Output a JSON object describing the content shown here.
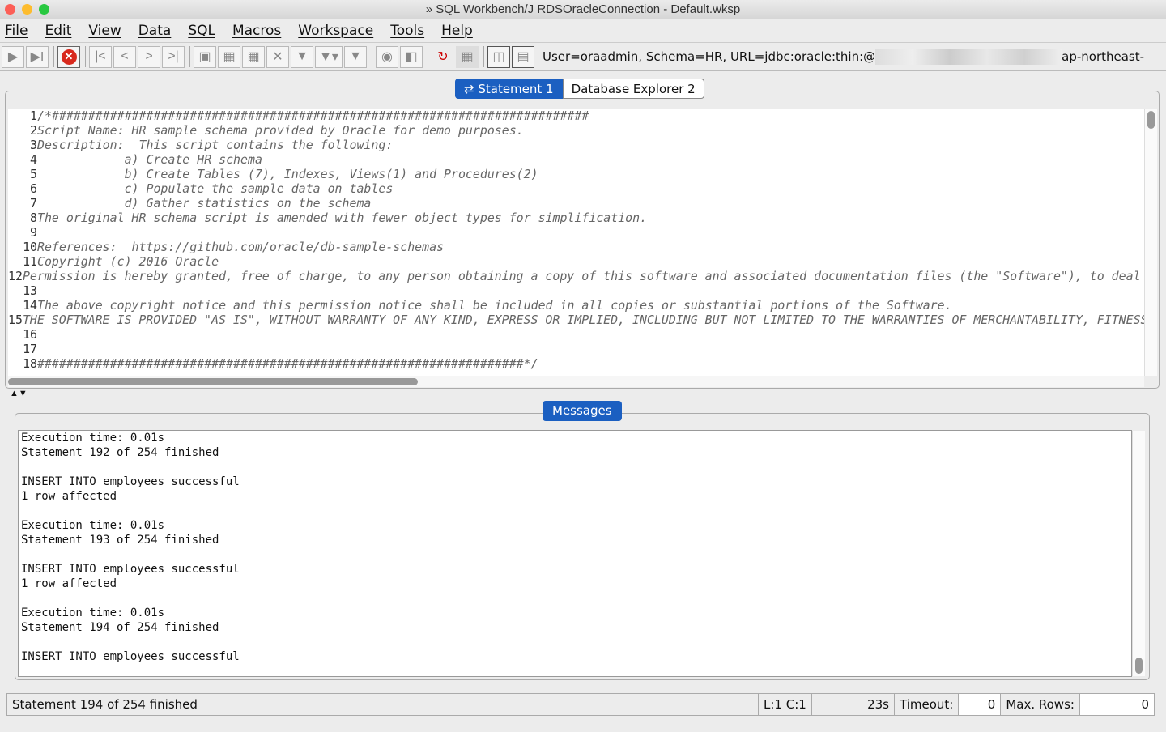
{
  "window": {
    "title": "» SQL Workbench/J RDSOracleConnection - Default.wksp"
  },
  "menu": [
    "File",
    "Edit",
    "View",
    "Data",
    "SQL",
    "Macros",
    "Workspace",
    "Tools",
    "Help"
  ],
  "toolbar": {
    "connection_prefix": "User=oraadmin, Schema=HR, URL=jdbc:oracle:thin:@",
    "connection_suffix": "ap-northeast-"
  },
  "tabs": [
    {
      "label": "Statement 1"
    },
    {
      "label": "Database Explorer 2"
    }
  ],
  "editor": {
    "lines": [
      "/*##########################################################################",
      "Script Name: HR sample schema provided by Oracle for demo purposes.",
      "Description:  This script contains the following:",
      "            a) Create HR schema",
      "            b) Create Tables (7), Indexes, Views(1) and Procedures(2)",
      "            c) Populate the sample data on tables",
      "            d) Gather statistics on the schema",
      "The original HR schema script is amended with fewer object types for simplification.",
      "",
      "References:  https://github.com/oracle/db-sample-schemas",
      "Copyright (c) 2016 Oracle",
      "Permission is hereby granted, free of charge, to any person obtaining a copy of this software and associated documentation files (the \"Software\"), to deal in the ...",
      "",
      "The above copyright notice and this permission notice shall be included in all copies or substantial portions of the Software.",
      "THE SOFTWARE IS PROVIDED \"AS IS\", WITHOUT WARRANTY OF ANY KIND, EXPRESS OR IMPLIED, INCLUDING BUT NOT LIMITED TO THE WARRANTIES OF MERCHANTABILITY, FITNESS FOR A ...",
      "",
      "",
      "###################################################################*/"
    ]
  },
  "messages": {
    "tab_label": "Messages",
    "text": "Execution time: 0.01s\nStatement 192 of 254 finished\n\nINSERT INTO employees successful\n1 row affected\n\nExecution time: 0.01s\nStatement 193 of 254 finished\n\nINSERT INTO employees successful\n1 row affected\n\nExecution time: 0.01s\nStatement 194 of 254 finished\n\nINSERT INTO employees successful"
  },
  "status": {
    "message": "Statement 194 of 254 finished",
    "position": "L:1 C:1",
    "elapsed": "23s",
    "timeout_label": "Timeout:",
    "timeout_value": "0",
    "maxrows_label": "Max. Rows:",
    "maxrows_value": "0"
  }
}
